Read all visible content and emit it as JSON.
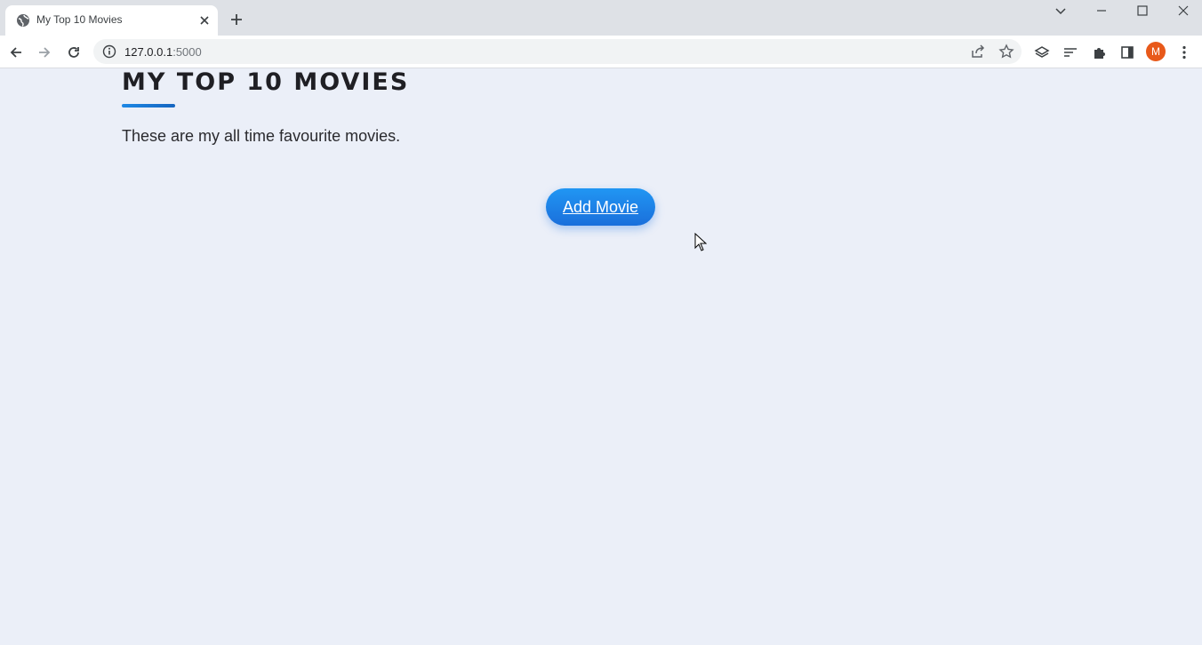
{
  "browser": {
    "tab": {
      "title": "My Top 10 Movies"
    },
    "address_bar": {
      "host": "127.0.0.1",
      "port": ":5000"
    },
    "profile_initial": "M"
  },
  "page": {
    "title": "MY TOP 10 MOVIES",
    "subtitle": "These are my all time favourite movies.",
    "add_button_label": "Add Movie"
  },
  "colors": {
    "accent": "#1a73e8",
    "page_background": "#ebeff8",
    "avatar": "#e8591a"
  }
}
